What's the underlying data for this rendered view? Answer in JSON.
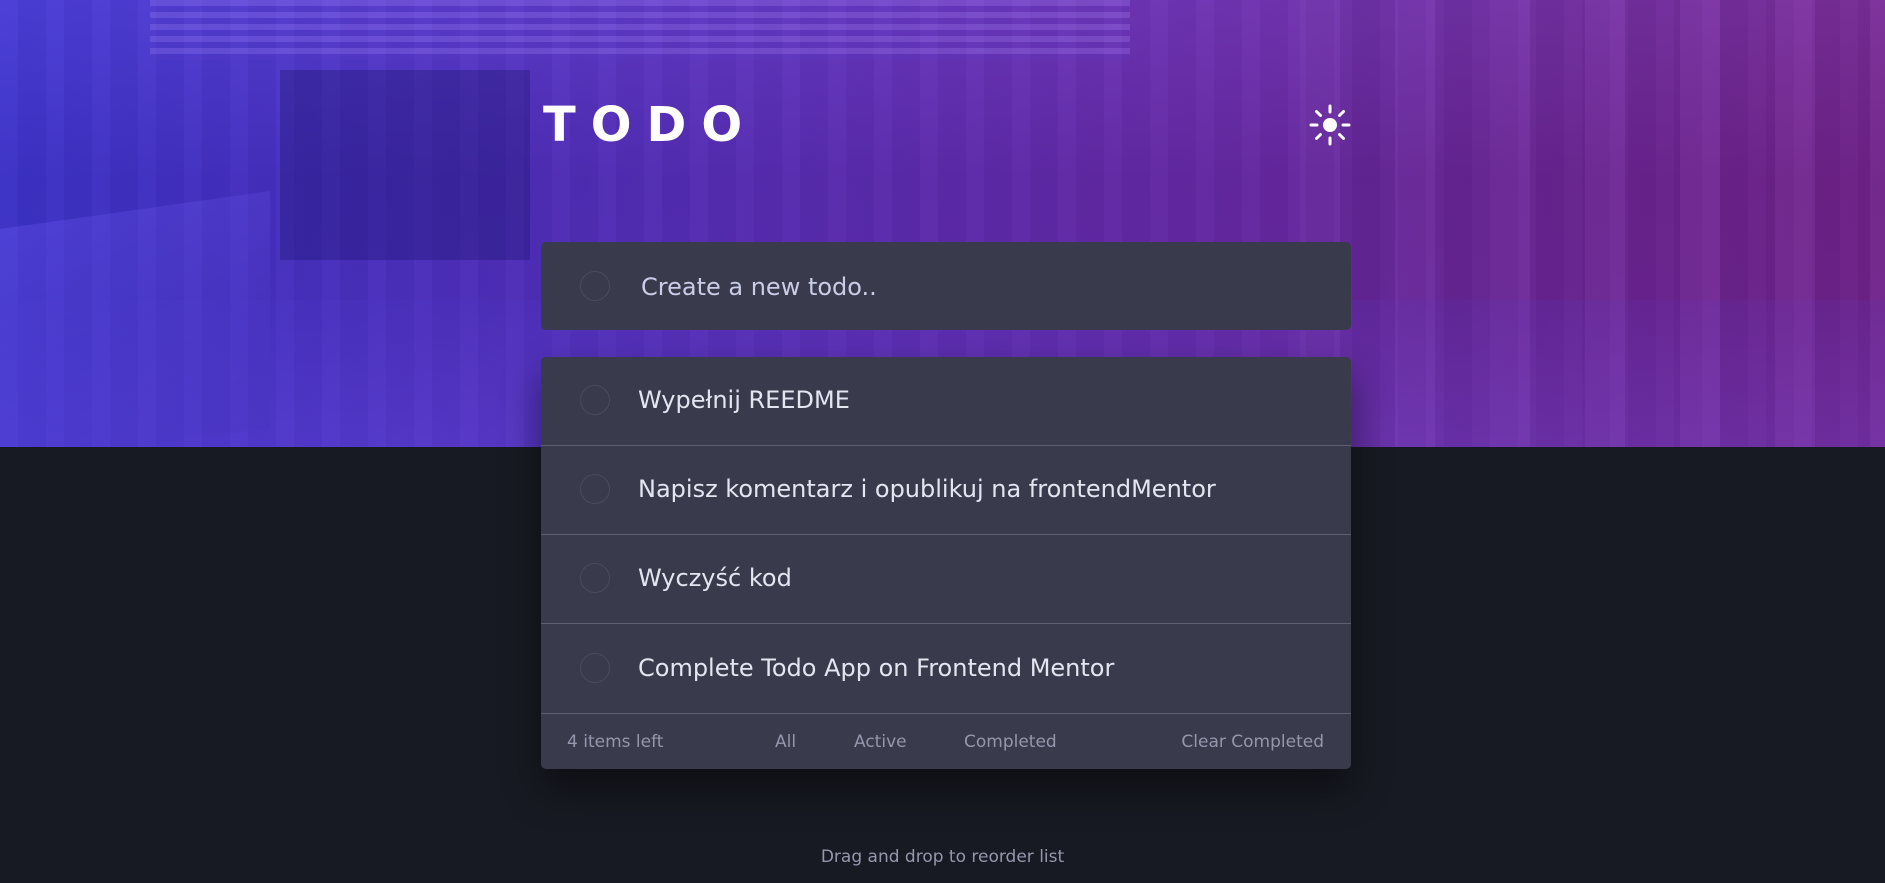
{
  "header": {
    "title": "TODO",
    "theme_icon": "sun-icon"
  },
  "new_todo": {
    "placeholder": "Create a new todo.."
  },
  "todos": [
    {
      "text": "Wypełnij REEDME",
      "completed": false
    },
    {
      "text": "Napisz komentarz i opublikuj na frontendMentor",
      "completed": false
    },
    {
      "text": "Wyczyść kod",
      "completed": false
    },
    {
      "text": "Complete Todo App on Frontend Mentor",
      "completed": false
    }
  ],
  "footer": {
    "items_left": "4 items left",
    "filters": [
      "All",
      "Active",
      "Completed"
    ],
    "clear_completed": "Clear Completed"
  },
  "hint": "Drag and drop to reorder list",
  "colors": {
    "background": "#181a23",
    "card": "#393a4b",
    "text": "#e4e5f1",
    "muted": "#9597ad",
    "divider": "#5e6072"
  }
}
